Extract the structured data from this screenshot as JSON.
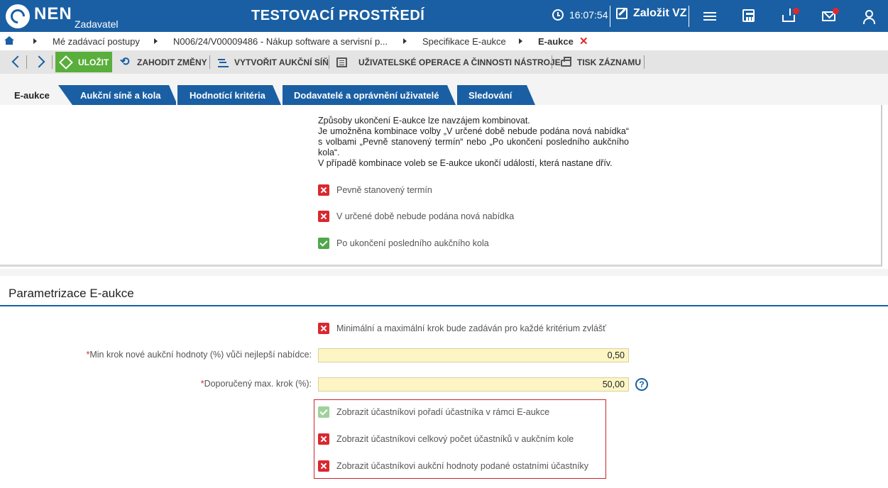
{
  "header": {
    "logo_text": "NEN",
    "logo_sub": "Zadavatel",
    "env_title": "TESTOVACÍ PROSTŘEDÍ",
    "time": "16:07:54",
    "new_vz_label": "Založit VZ",
    "icons": [
      "clock-icon",
      "edit-icon",
      "menu-icon",
      "calculator-icon",
      "inbox-icon",
      "mail-icon",
      "user-icon"
    ],
    "notification_color": "#e0282d",
    "brand_color": "#1a5fa3"
  },
  "breadcrumb": {
    "items": [
      "Mé zadávací postupy",
      "N006/24/V00009486 - Nákup software a servisní p...",
      "Specifikace E-aukce",
      "E-aukce"
    ],
    "close_symbol": "✕"
  },
  "toolbar": {
    "save_label": "ULOŽIT",
    "discard_label": "ZAHODIT ZMĚNY",
    "create_hall_label": "VYTVOŘIT AUKČNÍ SÍŇ",
    "operations_label": "UŽIVATELSKÉ OPERACE A ČINNOSTI NÁSTROJE",
    "print_label": "TISK ZÁZNAMU",
    "save_color": "#5aae3b"
  },
  "tabs": [
    {
      "label": "E-aukce",
      "active": true
    },
    {
      "label": "Aukční síně a kola",
      "active": false
    },
    {
      "label": "Hodnotící kritéria",
      "active": false
    },
    {
      "label": "Dodavatelé a oprávnění uživatelé",
      "active": false
    },
    {
      "label": "Sledování",
      "active": false
    }
  ],
  "ending": {
    "note_line1": "Způsoby ukončení E-aukce lze navzájem kombinovat.",
    "note_line2": "Je umožněna kombinace volby „V určené době nebude podána nová nabídka“ s volbami „Pevně stanovený termín“ nebo „Po ukončení posledního aukčního kola“.",
    "note_line3": "V případě kombinace voleb se E-aukce ukončí událostí, která nastane dřív.",
    "options": [
      {
        "label": "Pevně stanovený termín",
        "checked": false
      },
      {
        "label": "V určené době nebude podána nová nabídka",
        "checked": false
      },
      {
        "label": "Po ukončení posledního aukčního kola",
        "checked": true
      }
    ]
  },
  "parametrization": {
    "title": "Parametrizace E-aukce",
    "separate_step_label": "Minimální a maximální krok bude zadáván pro každé kritérium zvlášť",
    "separate_step_checked": false,
    "min_step_label": "Min krok nové aukční hodnoty (%) vůči nejlepší nabídce:",
    "min_step_value": "0,50",
    "max_step_label": "Doporučený max. krok (%):",
    "max_step_value": "50,00",
    "required_mark": "*",
    "help_symbol": "?",
    "display_options": [
      {
        "label": "Zobrazit účastníkovi pořadí účastníka v rámci E-aukce",
        "checked": true
      },
      {
        "label": "Zobrazit účastníkovi celkový počet účastníků v aukčním kole",
        "checked": false
      },
      {
        "label": "Zobrazit účastníkovi aukční hodnoty podané ostatními účastníky",
        "checked": false
      }
    ],
    "highlight_color": "#c9262d"
  }
}
